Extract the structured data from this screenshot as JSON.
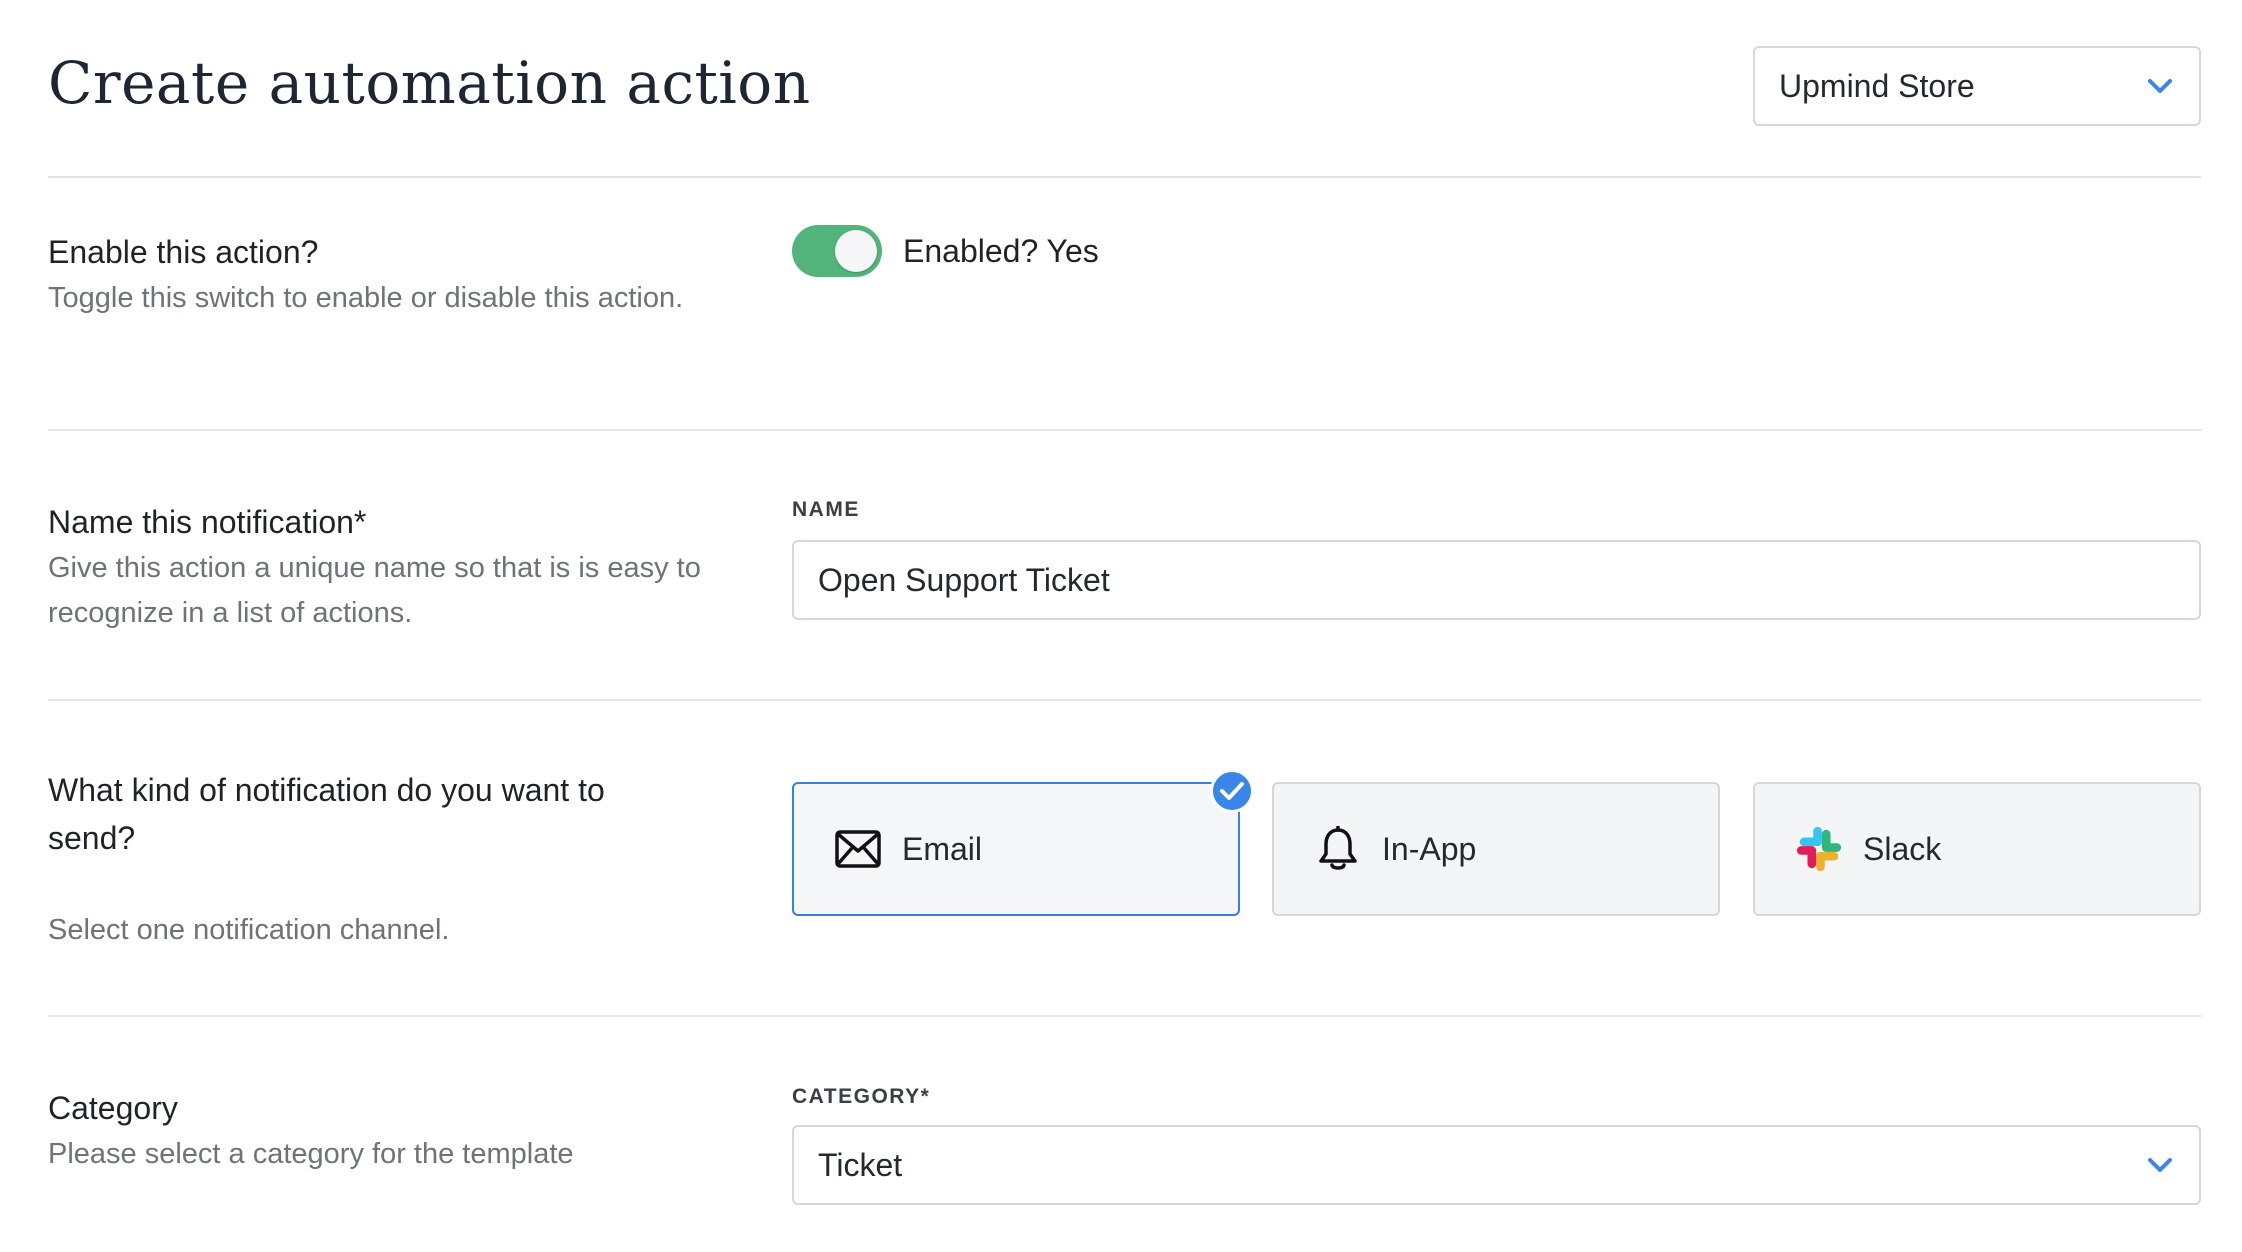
{
  "header": {
    "title": "Create automation action",
    "store_select": {
      "value": "Upmind Store",
      "icon": "chevron-down-icon"
    }
  },
  "enable_section": {
    "title": "Enable this action?",
    "description": "Toggle this switch to enable or disable this action.",
    "toggle": {
      "on": true,
      "label": "Enabled? Yes"
    }
  },
  "name_section": {
    "title": "Name this notification*",
    "description": "Give this action a unique name so that is is easy to recognize in a list of actions.",
    "field_label": "NAME",
    "field_value": "Open Support Ticket"
  },
  "channel_section": {
    "title": "What kind of notification do you want to send?",
    "description": "Select one notification channel.",
    "options": [
      {
        "label": "Email",
        "icon": "envelope-icon",
        "selected": true
      },
      {
        "label": "In-App",
        "icon": "bell-icon",
        "selected": false
      },
      {
        "label": "Slack",
        "icon": "slack-icon",
        "selected": false
      }
    ]
  },
  "category_section": {
    "title": "Category",
    "description": "Please select a category for the template",
    "field_label": "CATEGORY*",
    "field_value": "Ticket"
  },
  "colors": {
    "accent": "#3a86e8",
    "toggle_on": "#52b47a",
    "border": "#d4d7dc",
    "muted_text": "#6e7378"
  }
}
